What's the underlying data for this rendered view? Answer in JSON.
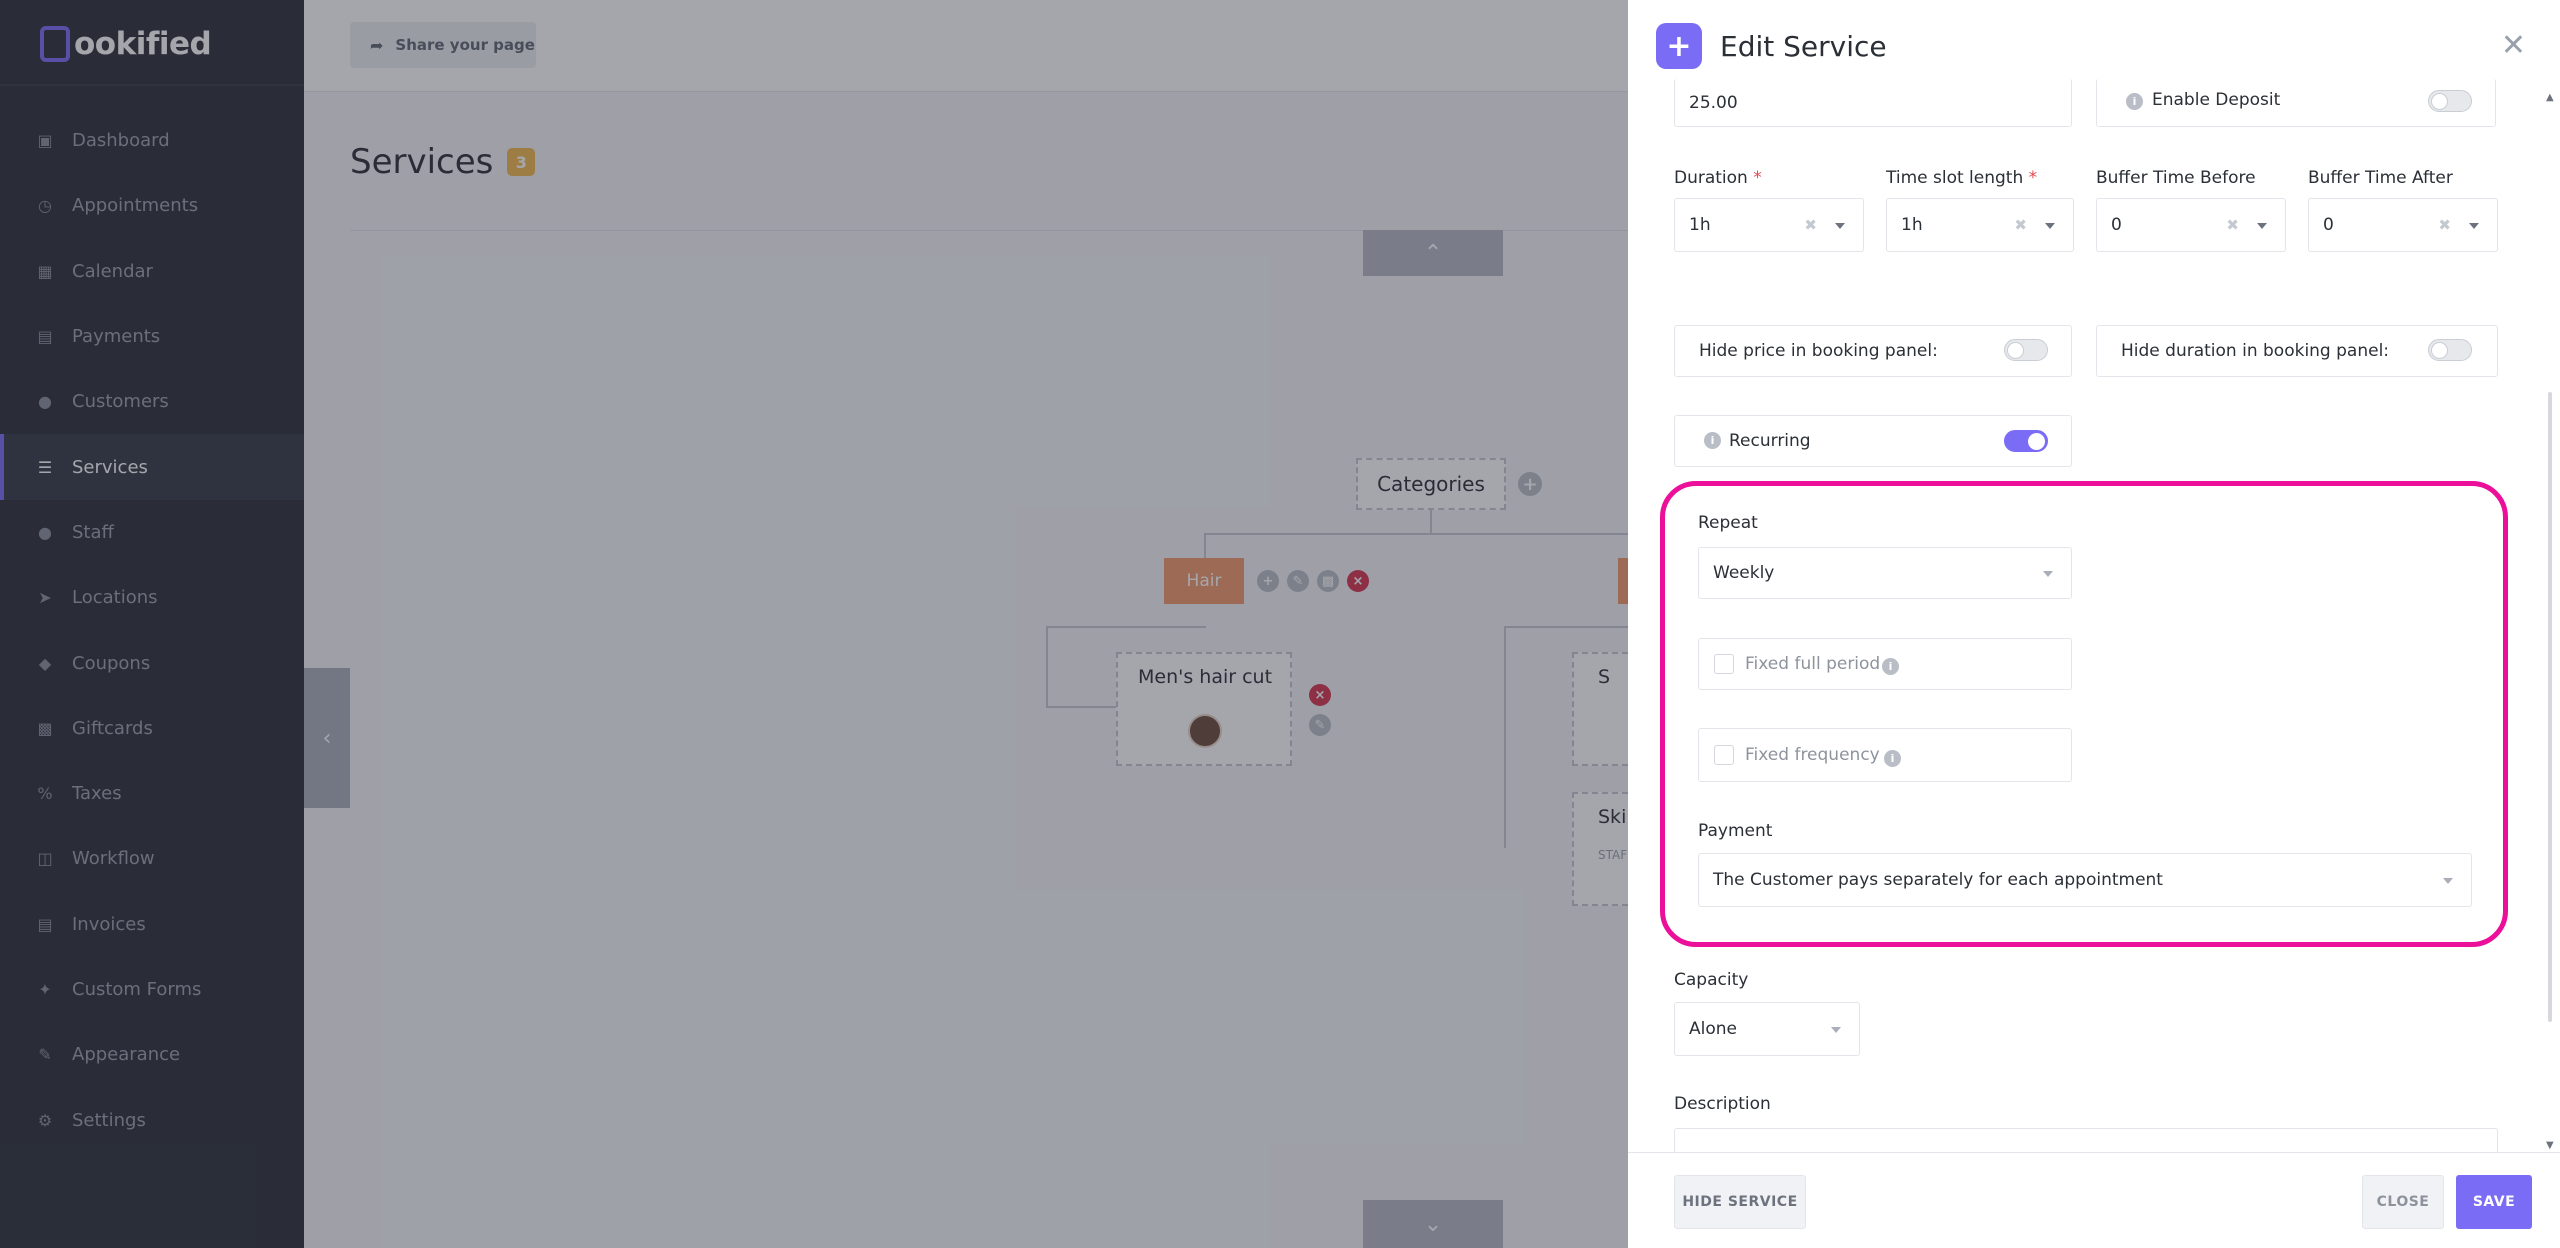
{
  "sidebar": {
    "logo": "ookified",
    "items": [
      {
        "label": "Dashboard",
        "icon": "cube-icon"
      },
      {
        "label": "Appointments",
        "icon": "clock-icon"
      },
      {
        "label": "Calendar",
        "icon": "calendar-icon"
      },
      {
        "label": "Payments",
        "icon": "wallet-icon"
      },
      {
        "label": "Customers",
        "icon": "users-icon"
      },
      {
        "label": "Services",
        "icon": "list-icon"
      },
      {
        "label": "Staff",
        "icon": "user-icon"
      },
      {
        "label": "Locations",
        "icon": "location-arrow-icon"
      },
      {
        "label": "Coupons",
        "icon": "tag-icon"
      },
      {
        "label": "Giftcards",
        "icon": "gift-icon"
      },
      {
        "label": "Taxes",
        "icon": "percent-icon"
      },
      {
        "label": "Workflow",
        "icon": "workflow-icon"
      },
      {
        "label": "Invoices",
        "icon": "file-icon"
      },
      {
        "label": "Custom Forms",
        "icon": "wand-icon"
      },
      {
        "label": "Appearance",
        "icon": "brush-icon"
      },
      {
        "label": "Settings",
        "icon": "gear-icon"
      }
    ],
    "active": "Services"
  },
  "main": {
    "share_label": "Share your page",
    "title": "Services",
    "count": "3",
    "categories_label": "Categories",
    "category_hair": "Hair",
    "service_1": "Men's hair cut",
    "service_2_partial": "S",
    "service_3_partial": "Skir",
    "service_3_sub_partial": "STAF"
  },
  "panel": {
    "title": "Edit Service",
    "price_value": "25.00",
    "enable_deposit_label": "Enable Deposit",
    "duration_label": "Duration",
    "duration_value": "1h",
    "timeslot_label": "Time slot length",
    "timeslot_value": "1h",
    "buffer_before_label": "Buffer Time Before",
    "buffer_before_value": "0",
    "buffer_after_label": "Buffer Time After",
    "buffer_after_value": "0",
    "required_mark": "*",
    "hide_price_label": "Hide price in booking panel:",
    "hide_duration_label": "Hide duration in booking panel:",
    "recurring_label": "Recurring",
    "recurring_on": true,
    "repeat_label": "Repeat",
    "repeat_value": "Weekly",
    "fixed_full_period_label": "Fixed full period",
    "fixed_frequency_label": "Fixed frequency",
    "payment_label": "Payment",
    "payment_value": "The Customer pays separately for each appointment",
    "capacity_label": "Capacity",
    "capacity_value": "Alone",
    "description_label": "Description"
  },
  "footer": {
    "hide_service": "HIDE SERVICE",
    "close": "CLOSE",
    "save": "SAVE"
  },
  "colors": {
    "accent": "#7b6cf6",
    "highlight": "#ec0f9a",
    "category": "#f29a6a",
    "badge": "#f2b84b"
  }
}
